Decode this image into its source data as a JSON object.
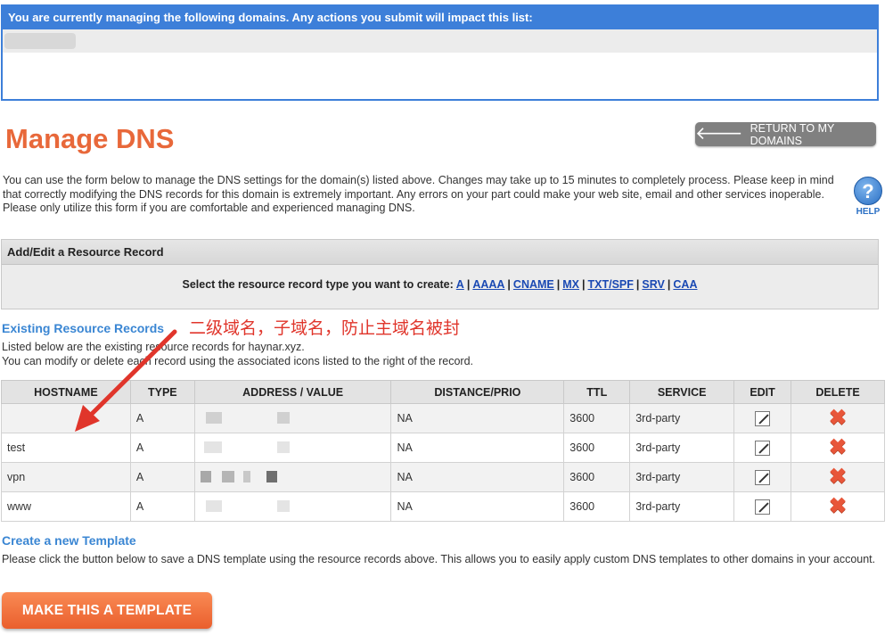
{
  "domain_box": {
    "heading": "You are currently managing the following domains. Any actions you submit will impact this list:"
  },
  "page": {
    "title": "Manage DNS",
    "return_button": "RETURN TO MY DOMAINS",
    "intro": "You can use the form below to manage the DNS settings for the domain(s) listed above. Changes may take up to 15 minutes to completely process. Please keep in mind that correctly modifying the DNS records for this domain is extremely important. Any errors on your part could make your web site, email and other services inoperable. Please only utilize this form if you are comfortable and experienced managing DNS.",
    "help_label": "HELP"
  },
  "resource_panel": {
    "heading": "Add/Edit a Resource Record",
    "prompt": "Select the resource record type you want to create:",
    "types": [
      "A",
      "AAAA",
      "CNAME",
      "MX",
      "TXT/SPF",
      "SRV",
      "CAA"
    ]
  },
  "existing": {
    "title": "Existing Resource Records",
    "line1": "Listed below are the existing resource records for haynar.xyz.",
    "line2": "You can modify or delete each record using the associated icons listed to the right of the record.",
    "annotation": "二级域名，子域名，防止主域名被封"
  },
  "table": {
    "headers": [
      "HOSTNAME",
      "TYPE",
      "ADDRESS / VALUE",
      "DISTANCE/PRIO",
      "TTL",
      "SERVICE",
      "EDIT",
      "DELETE"
    ],
    "rows": [
      {
        "hostname": "",
        "type": "A",
        "distance": "NA",
        "ttl": "3600",
        "service": "3rd-party"
      },
      {
        "hostname": "test",
        "type": "A",
        "distance": "NA",
        "ttl": "3600",
        "service": "3rd-party"
      },
      {
        "hostname": "vpn",
        "type": "A",
        "distance": "NA",
        "ttl": "3600",
        "service": "3rd-party"
      },
      {
        "hostname": "www",
        "type": "A",
        "distance": "NA",
        "ttl": "3600",
        "service": "3rd-party"
      }
    ]
  },
  "template": {
    "title": "Create a new Template",
    "desc": "Please click the button below to save a DNS template using the resource records above. This allows you to easily apply custom DNS templates to other domains in your account.",
    "button": "MAKE THIS A TEMPLATE"
  },
  "colors": {
    "accent_blue": "#3d7fd9",
    "title_orange": "#e8683a",
    "link_blue": "#1a49b3",
    "annotation_red": "#e0352b"
  }
}
